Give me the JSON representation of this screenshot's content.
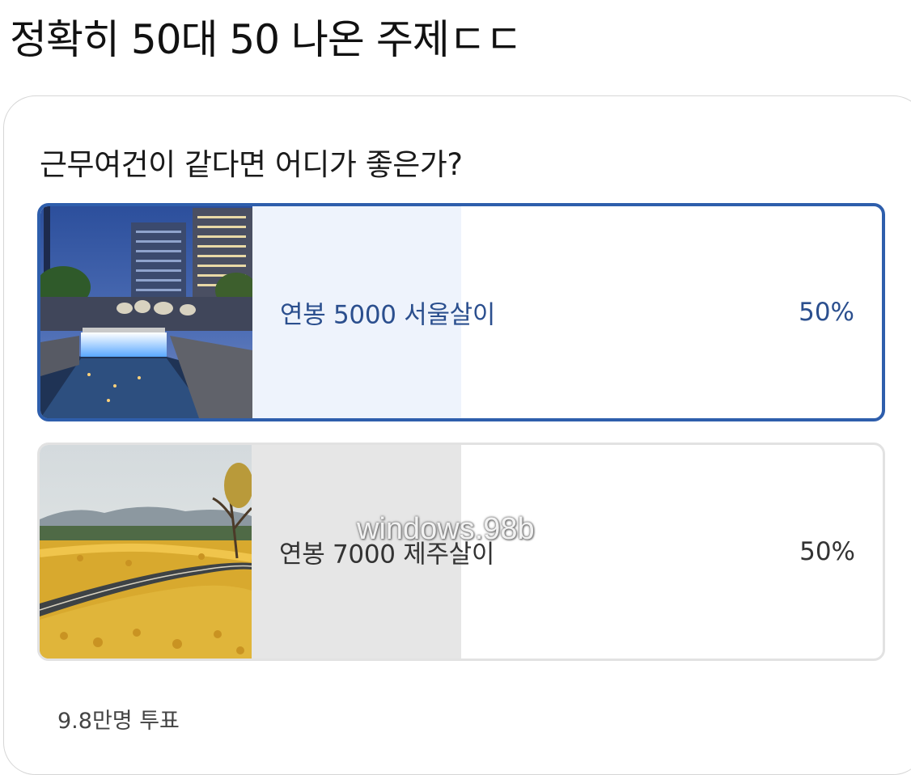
{
  "post": {
    "title": "정확히 50대 50 나온 주제ㄷㄷ"
  },
  "poll": {
    "question": "근무여건이 같다면 어디가 좋은가?",
    "options": [
      {
        "label": "연봉 5000 서울살이",
        "percent_text": "50%",
        "percent": 50,
        "selected": true,
        "image": "seoul-cheonggyecheon-night-image"
      },
      {
        "label": "연봉 7000 제주살이",
        "percent_text": "50%",
        "percent": 50,
        "selected": false,
        "image": "jeju-canola-road-image"
      }
    ],
    "vote_count": "9.8만명 투표"
  },
  "watermark": "windows.98b",
  "colors": {
    "selected_border": "#2e5eac",
    "selected_text": "#2b4f8e",
    "selected_fill": "#eef3fc",
    "unselected_fill": "#e6e6e6",
    "unselected_border": "#e2e2e2"
  }
}
